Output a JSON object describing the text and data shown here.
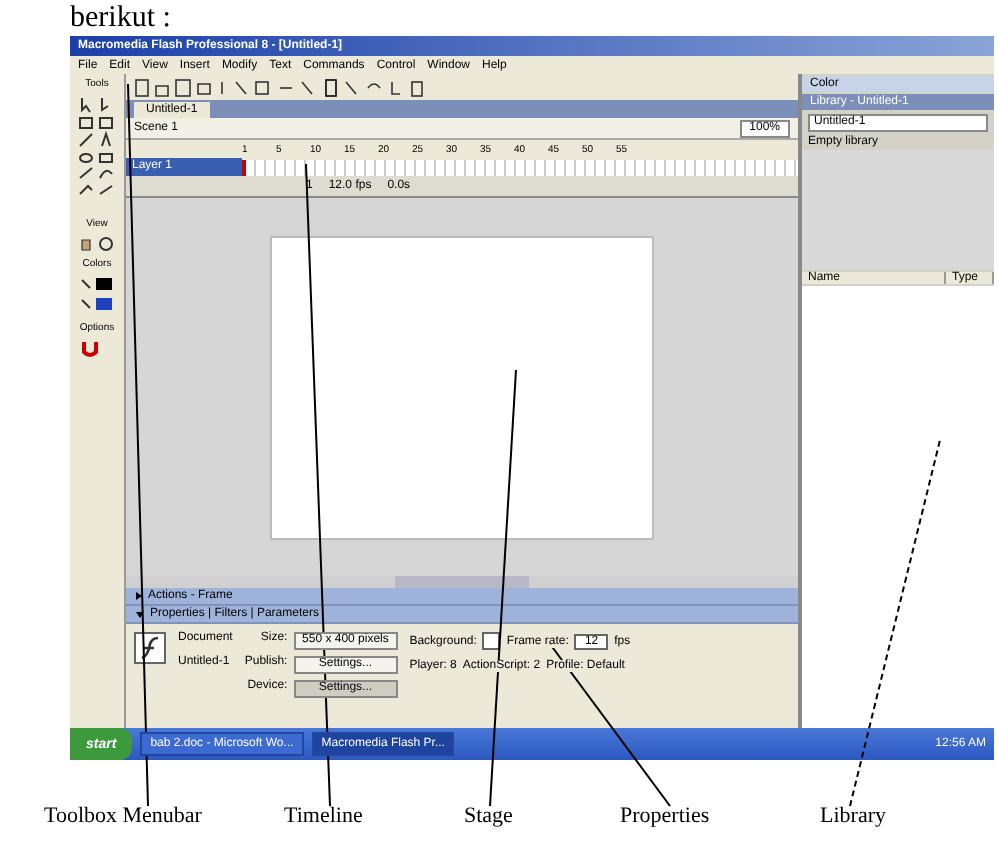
{
  "caption": "berikut :",
  "window": {
    "title": "Macromedia Flash Professional 8 - [Untitled-1]"
  },
  "menu": [
    "File",
    "Edit",
    "View",
    "Insert",
    "Modify",
    "Text",
    "Commands",
    "Control",
    "Window",
    "Help"
  ],
  "toolbox": {
    "title": "Tools",
    "sections": [
      "View",
      "Colors",
      "Options"
    ]
  },
  "document_tab": "Untitled-1",
  "scene": "Scene 1",
  "zoom": "100%",
  "timeline": {
    "layer": "Layer 1",
    "frames": [
      "1",
      "5",
      "10",
      "15",
      "20",
      "25",
      "30",
      "35",
      "40",
      "45",
      "50",
      "55"
    ],
    "status": [
      "1",
      "12.0 fps",
      "0.0s"
    ]
  },
  "properties": {
    "panels": [
      {
        "label": "Actions - Frame",
        "expanded": false
      },
      {
        "label": "Properties | Filters | Parameters",
        "expanded": true
      }
    ],
    "doc_kind": "Document",
    "doc_name": "Untitled-1",
    "size_label": "Size:",
    "size": "550 x 400 pixels",
    "publish_label": "Publish:",
    "publish": "Settings...",
    "device_label": "Device:",
    "device": "Settings...",
    "bg_label": "Background:",
    "fps_label": "Frame rate:",
    "fps": "12",
    "fps_unit": "fps",
    "player": "Player: 8",
    "actionscript": "ActionScript: 2",
    "profile": "Profile: Default"
  },
  "library": {
    "color_panel": "Color",
    "title": "Library - Untitled-1",
    "doc": "Untitled-1",
    "empty": "Empty library",
    "columns": [
      "Name",
      "Type"
    ]
  },
  "taskbar": {
    "start": "start",
    "tasks": [
      {
        "label": "bab 2.doc - Microsoft Wo...",
        "selected": false
      },
      {
        "label": "Macromedia Flash Pr...",
        "selected": true
      }
    ],
    "clock": "12:56 AM"
  },
  "annotations": [
    "Toolbox Menubar",
    "Timeline",
    "Stage",
    "Properties",
    "Library"
  ]
}
